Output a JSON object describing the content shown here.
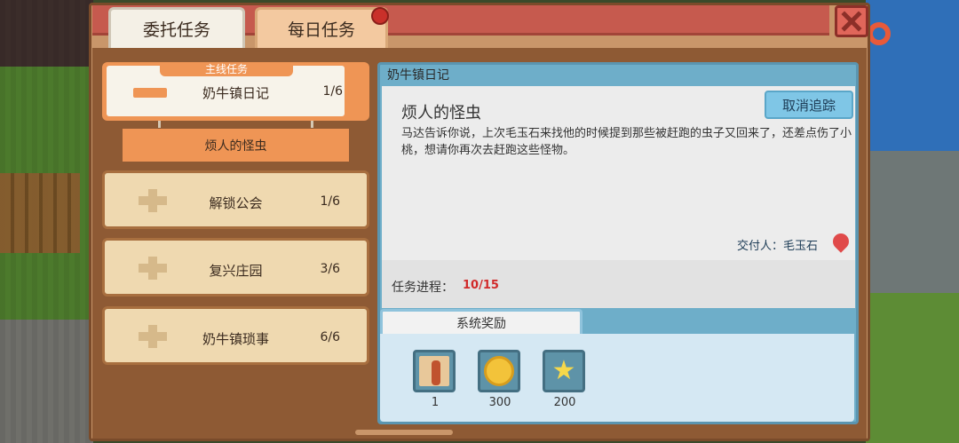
{
  "tabs": {
    "commission": "委托任务",
    "daily": "每日任务"
  },
  "quest_list": {
    "main": {
      "header": "主线任务",
      "label": "奶牛镇日记",
      "count": "1/6"
    },
    "active_subquest": "烦人的怪虫",
    "items": [
      {
        "label": "解锁公会",
        "count": "1/6"
      },
      {
        "label": "复兴庄园",
        "count": "3/6"
      },
      {
        "label": "奶牛镇琐事",
        "count": "6/6"
      }
    ]
  },
  "detail": {
    "title": "奶牛镇日记",
    "heading": "烦人的怪虫",
    "cancel_label": "取消追踪",
    "description": "马达告诉你说，上次毛玉石来找他的时候提到那些被赶跑的虫子又回来了，还差点伤了小桃，想请你再次去赶跑这些怪物。",
    "giver": "交付人：毛玉石",
    "progress_label": "任务进程：",
    "progress_value": "10/15"
  },
  "rewards": {
    "tab_label": "系统奖励",
    "items": [
      {
        "icon": "scroll-item-icon",
        "count": "1"
      },
      {
        "icon": "gold-coin-icon",
        "count": "300"
      },
      {
        "icon": "star-icon",
        "count": "200"
      }
    ]
  },
  "colors": {
    "accent_orange": "#ef9555",
    "title_red": "#c65a4e",
    "panel_blue": "#6eaec9",
    "progress_red": "#d12a2a"
  }
}
